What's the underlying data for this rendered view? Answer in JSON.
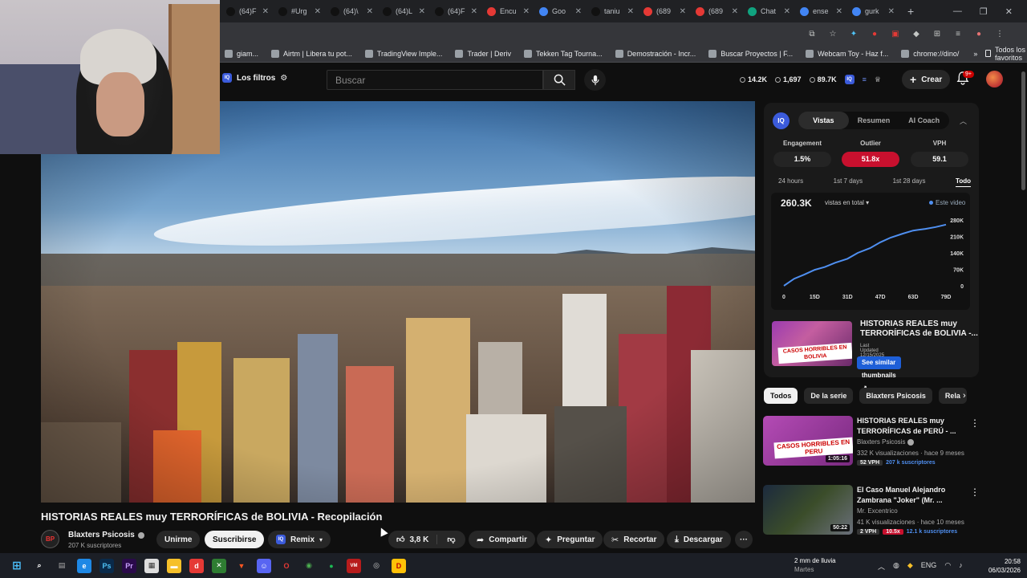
{
  "browser": {
    "tabs": [
      {
        "title": "(64)F",
        "icon": "tiktok-icon"
      },
      {
        "title": "#Urg",
        "icon": "tiktok-icon"
      },
      {
        "title": "(64)\\",
        "icon": "tiktok-icon"
      },
      {
        "title": "(64)L",
        "icon": "tiktok-icon"
      },
      {
        "title": "(64)F",
        "icon": "tiktok-icon"
      },
      {
        "title": "Encu",
        "icon": "form-icon"
      },
      {
        "title": "Goo",
        "icon": "google-icon"
      },
      {
        "title": "taniu",
        "icon": "tiktok-icon"
      },
      {
        "title": "(689",
        "icon": "youtube-icon"
      },
      {
        "title": "(689",
        "icon": "youtube-icon"
      },
      {
        "title": "Chat",
        "icon": "chatgpt-icon"
      },
      {
        "title": "ense",
        "icon": "google-icon"
      },
      {
        "title": "gurk",
        "icon": "google-icon"
      }
    ],
    "new_tab": "+",
    "bookmarks": [
      "giam...",
      "Airtm | Libera tu pot...",
      "TradingView Imple...",
      "Trader | Deriv",
      "Tekken Tag Tourna...",
      "Demostración - Incr...",
      "Buscar Proyectos | F...",
      "Webcam Toy - Haz f...",
      "chrome://dino/"
    ],
    "bookmarks_more": "»",
    "bookmarks_folder": "Todos los favoritos"
  },
  "header": {
    "filters_label": "Los filtros",
    "search_placeholder": "Buscar",
    "stats": [
      "14.2K",
      "1,697",
      "89.7K"
    ],
    "create_label": "Crear",
    "notif_count": "9+"
  },
  "video": {
    "title": "HISTORIAS REALES muy TERRORÍFICAS de BOLIVIA - Recopilación",
    "channel": "Blaxters Psicosis",
    "subscribers": "207 K suscriptores",
    "join_label": "Unirme",
    "subscribe_label": "Suscribirse",
    "remix_label": "Remix",
    "likes": "3,8 K",
    "share_label": "Compartir",
    "ask_label": "Preguntar",
    "clip_label": "Recortar",
    "download_label": "Descargar",
    "more_label": "···"
  },
  "vidiq": {
    "logo": "IQ",
    "tabs": [
      "Vistas",
      "Resumen",
      "AI Coach"
    ],
    "metrics": [
      {
        "label": "Engagement",
        "value": "1.5%"
      },
      {
        "label": "Outlier",
        "value": "51.8x"
      },
      {
        "label": "VPH",
        "value": "59.1"
      }
    ],
    "ranges": [
      "24 hours",
      "1st 7 days",
      "1st 28 days",
      "Todo"
    ],
    "total_views": "260.3K",
    "views_selector": "vistas en total",
    "legend": "Este video",
    "thumb_title": "HISTORIAS REALES muy TERRORÍFICAS de BOLIVIA -...",
    "thumb_caption": "CASOS HORRIBLES EN BOLIVIA",
    "last_updated": "Last Updated 12/15/2025",
    "similar_label": "See similar thumbnails ↗"
  },
  "chart_data": {
    "type": "line",
    "x_tick_labels": [
      "0",
      "15D",
      "31D",
      "47D",
      "63D",
      "79D"
    ],
    "y_tick_labels": [
      "0",
      "70K",
      "140K",
      "210K",
      "280K"
    ],
    "ylim": [
      0,
      280000
    ],
    "x_days": [
      0,
      5,
      10,
      15,
      20,
      25,
      31,
      36,
      42,
      47,
      52,
      58,
      63,
      69,
      74,
      79
    ],
    "values": [
      0,
      30000,
      48000,
      68000,
      80000,
      98000,
      115000,
      140000,
      160000,
      185000,
      205000,
      222000,
      235000,
      242000,
      250000,
      260300
    ],
    "series": [
      {
        "name": "Este video"
      }
    ]
  },
  "chips": [
    "Todos",
    "De la serie",
    "Blaxters Psicosis",
    "Rela"
  ],
  "recommendations": [
    {
      "title": "HISTORIAS REALES muy TERRORÍFICAS de PERÚ - ...",
      "channel": "Blaxters Psicosis",
      "meta": "332 K visualizaciones · hace 9 meses",
      "duration": "1:05:16",
      "caption": "CASOS HORRIBLES EN PERU",
      "vph": "52 VPH",
      "extra": "207 k suscriptores"
    },
    {
      "title": "El Caso Manuel Alejandro Zambrana \"Joker\" (Mr. ...",
      "channel": "Mr. Excentrico",
      "meta": "41 K visualizaciones · hace 10 meses",
      "duration": "50:22",
      "caption": "",
      "vph": "2 VPH",
      "outlier": "10.5x",
      "extra": "12.1 k suscriptores"
    }
  ],
  "taskbar": {
    "weather_line1": "2 mm de lluvia",
    "weather_line2": "Martes",
    "lang": "ENG",
    "time": "20:58",
    "date": "06/03/2026"
  },
  "colors": {
    "background": "#0f0f0f",
    "accent_red": "#c8102e",
    "vidiq_blue": "#3b5bdb",
    "chart_line": "#4f8ff0"
  }
}
